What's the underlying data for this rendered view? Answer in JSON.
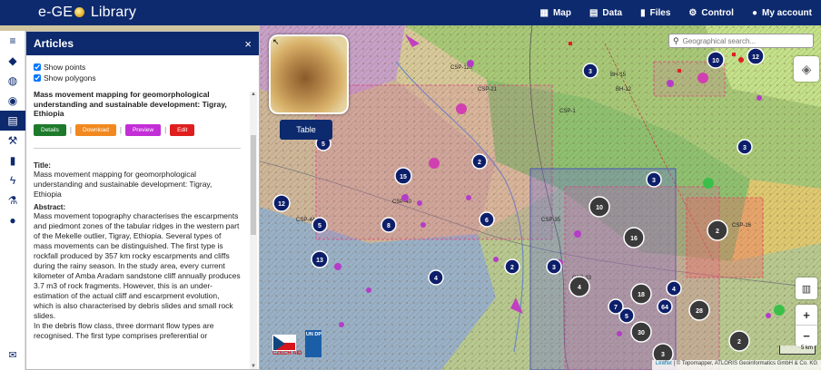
{
  "app": {
    "logo_left": "e-GE",
    "logo_right": "Library"
  },
  "nav": [
    {
      "icon": "map-icon",
      "glyph": "▦",
      "label": "Map"
    },
    {
      "icon": "data-icon",
      "glyph": "▤",
      "label": "Data"
    },
    {
      "icon": "files-icon",
      "glyph": "▮",
      "label": "Files"
    },
    {
      "icon": "control-icon",
      "glyph": "⚙",
      "label": "Control"
    },
    {
      "icon": "account-icon",
      "glyph": "●",
      "label": "My account"
    }
  ],
  "rail": [
    {
      "name": "menu-icon",
      "glyph": "≡"
    },
    {
      "name": "layers-icon",
      "glyph": "◆"
    },
    {
      "name": "globe-icon",
      "glyph": "◍"
    },
    {
      "name": "eye-icon",
      "glyph": "◉"
    },
    {
      "name": "articles-icon",
      "glyph": "▤",
      "active": true
    },
    {
      "name": "hammer-icon",
      "glyph": "⚒"
    },
    {
      "name": "book-icon",
      "glyph": "▮"
    },
    {
      "name": "bolt-icon",
      "glyph": "ϟ"
    },
    {
      "name": "flask-icon",
      "glyph": "⚗"
    },
    {
      "name": "drop-icon",
      "glyph": "●"
    }
  ],
  "rail_bottom": {
    "name": "mail-icon",
    "glyph": "✉"
  },
  "panel": {
    "title": "Articles",
    "close": "×",
    "show_points": "Show points",
    "show_polygons": "Show polygons",
    "article_title": "Mass movement mapping for geomorphological understanding and sustainable development: Tigray, Ethiopia",
    "buttons": {
      "details": "Details",
      "download": "Download",
      "preview": "Preview",
      "edit": "Edit",
      "sep": "|"
    },
    "title_label": "Title:",
    "title_value": "Mass movement mapping for geomorphological understanding and sustainable development: Tigray, Ethiopia",
    "abstract_label": "Abstract:",
    "abstract_1": "Mass movement topography characterises the escarpments and piedmont zones of the tabular ridges in the western part of the Mekelle outlier, Tigray, Ethiopia. Several types of mass movements can be distinguished. The first type is rockfall produced by 357 km rocky escarpments and cliffs during the rainy season. In the study area, every current kilometer of Amba Aradam sandstone cliff annually produces 3.7 m3 of rock fragments. However, this is an under-estimation of the actual cliff and escarpment evolution, which is also characterised by debris slides and small rock slides.",
    "abstract_2": "In the debris flow class, three dormant flow types are recognised. The first type comprises preferential or"
  },
  "map": {
    "table_button": "Table",
    "search_placeholder": "Geographical search...",
    "scale_label": "5 km",
    "attribution_leaflet": "Leaflet",
    "attribution_rest": "| © Topomapper, ATLORIS Geoinformatics GmbH & Co. KG",
    "flag_text": "CZECH AID",
    "undp_text": "UN DP",
    "clusters_blue": [
      "3",
      "10",
      "12",
      "3",
      "5",
      "2",
      "15",
      "2",
      "12",
      "5",
      "6",
      "8",
      "13",
      "4",
      "2",
      "3",
      "4",
      "5",
      "7"
    ],
    "clusters_grey": [
      "10",
      "16",
      "2",
      "4",
      "18",
      "28",
      "30",
      "2",
      "3",
      "4"
    ],
    "labels": [
      "CSP-120",
      "CSP-21",
      "CSP-35",
      "CSP-40",
      "CSP-16",
      "CSP-44",
      "CSP-1",
      "BH-15",
      "BH-12",
      "CSP-33"
    ]
  },
  "colors": {
    "nav": "#0d2a6e",
    "cluster_blue": "#0d1f6a",
    "cluster_grey": "#3a3a3a",
    "poi": "#b43cc8"
  }
}
